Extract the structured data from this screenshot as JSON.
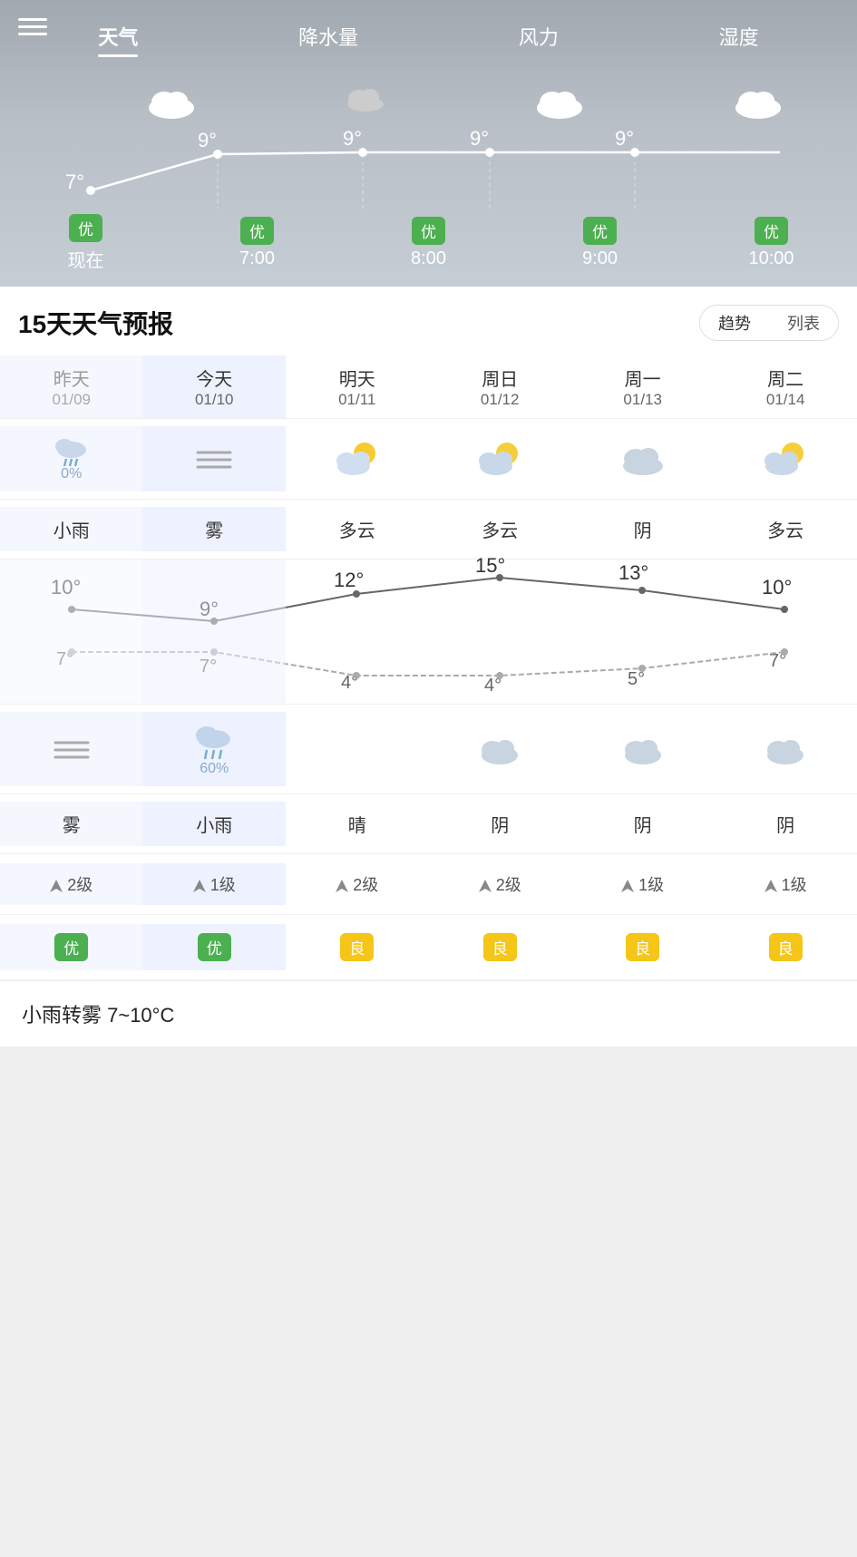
{
  "tabs": [
    {
      "label": "天气",
      "active": true
    },
    {
      "label": "降水量",
      "active": false
    },
    {
      "label": "风力",
      "active": false
    },
    {
      "label": "湿度",
      "active": false
    }
  ],
  "hourly": [
    {
      "time": "现在",
      "temp": "7°",
      "aqi": "优",
      "icon": "cloud"
    },
    {
      "time": "7:00",
      "temp": "9°",
      "aqi": "优",
      "icon": "cloud"
    },
    {
      "time": "8:00",
      "temp": "9°",
      "aqi": "优",
      "icon": "cloud-small"
    },
    {
      "time": "9:00",
      "temp": "9°",
      "aqi": "优",
      "icon": "cloud"
    },
    {
      "time": "10:00",
      "temp": "9°",
      "aqi": "优",
      "icon": "cloud"
    }
  ],
  "forecast_title": "15天天气预报",
  "view_trend": "趋势",
  "view_list": "列表",
  "days": [
    {
      "name": "昨天",
      "date": "01/09",
      "weather_day": "小雨",
      "weather_night": "雾",
      "high": 10,
      "low": 7,
      "precip": "0%",
      "wind": "2级",
      "aqi": "优",
      "aqi_color": "green",
      "icon_day": "rain",
      "icon_night": "fog"
    },
    {
      "name": "今天",
      "date": "01/10",
      "weather_day": "雾",
      "weather_night": "小雨",
      "high": 9,
      "low": 7,
      "precip": "60%",
      "wind": "1级",
      "aqi": "优",
      "aqi_color": "green",
      "icon_day": "fog-lines",
      "icon_night": "rain-cloud"
    },
    {
      "name": "明天",
      "date": "01/11",
      "weather_day": "多云",
      "weather_night": "晴",
      "high": 12,
      "low": 4,
      "precip": "",
      "wind": "2级",
      "aqi": "良",
      "aqi_color": "yellow",
      "icon_day": "partly-cloudy",
      "icon_night": "moon"
    },
    {
      "name": "周日",
      "date": "01/12",
      "weather_day": "多云",
      "weather_night": "阴",
      "high": 15,
      "low": 4,
      "precip": "",
      "wind": "2级",
      "aqi": "良",
      "aqi_color": "yellow",
      "icon_day": "partly-cloudy2",
      "icon_night": "cloud-gray"
    },
    {
      "name": "周一",
      "date": "01/13",
      "weather_day": "阴",
      "weather_night": "阴",
      "high": 13,
      "low": 5,
      "precip": "",
      "wind": "1级",
      "aqi": "良",
      "aqi_color": "yellow",
      "icon_day": "cloudy",
      "icon_night": "cloud-gray"
    },
    {
      "name": "周二",
      "date": "01/14",
      "weather_day": "多云",
      "weather_night": "阴",
      "high": 10,
      "low": 7,
      "precip": "",
      "wind": "1级",
      "aqi": "良",
      "aqi_color": "yellow",
      "icon_day": "partly-cloudy3",
      "icon_night": "cloud-gray"
    }
  ],
  "bottom_bar": "小雨转雾  7~10°C"
}
